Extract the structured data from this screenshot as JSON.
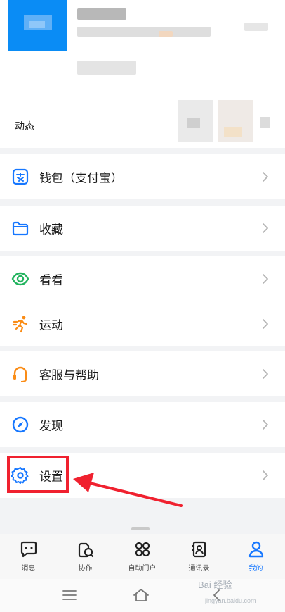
{
  "profile": {
    "dynamic_label": "动态"
  },
  "menu": [
    {
      "id": "wallet",
      "label": "钱包（支付宝）",
      "icon": "wallet-icon"
    },
    {
      "id": "favorites",
      "label": "收藏",
      "icon": "folder-icon"
    },
    {
      "id": "look",
      "label": "看看",
      "icon": "eye-icon"
    },
    {
      "id": "sport",
      "label": "运动",
      "icon": "running-icon"
    },
    {
      "id": "help",
      "label": "客服与帮助",
      "icon": "headset-icon"
    },
    {
      "id": "discover",
      "label": "发现",
      "icon": "compass-icon"
    },
    {
      "id": "settings",
      "label": "设置",
      "icon": "gear-icon"
    }
  ],
  "tabbar": {
    "items": [
      {
        "label": "消息",
        "icon": "message-icon",
        "active": false
      },
      {
        "label": "协作",
        "icon": "collaboration-icon",
        "active": false
      },
      {
        "label": "自助门户",
        "icon": "portal-grid-icon",
        "active": false
      },
      {
        "label": "通讯录",
        "icon": "contacts-icon",
        "active": false
      },
      {
        "label": "我的",
        "icon": "person-icon",
        "active": true
      }
    ]
  },
  "watermark": {
    "text": "Bai 经验",
    "url": "jingyan.baidu.com"
  },
  "colors": {
    "accent": "#1677ff",
    "highlight": "#f0212f",
    "avatar": "#0a8cf5",
    "icon_green": "#22b35e",
    "icon_orange": "#fa8c16"
  }
}
